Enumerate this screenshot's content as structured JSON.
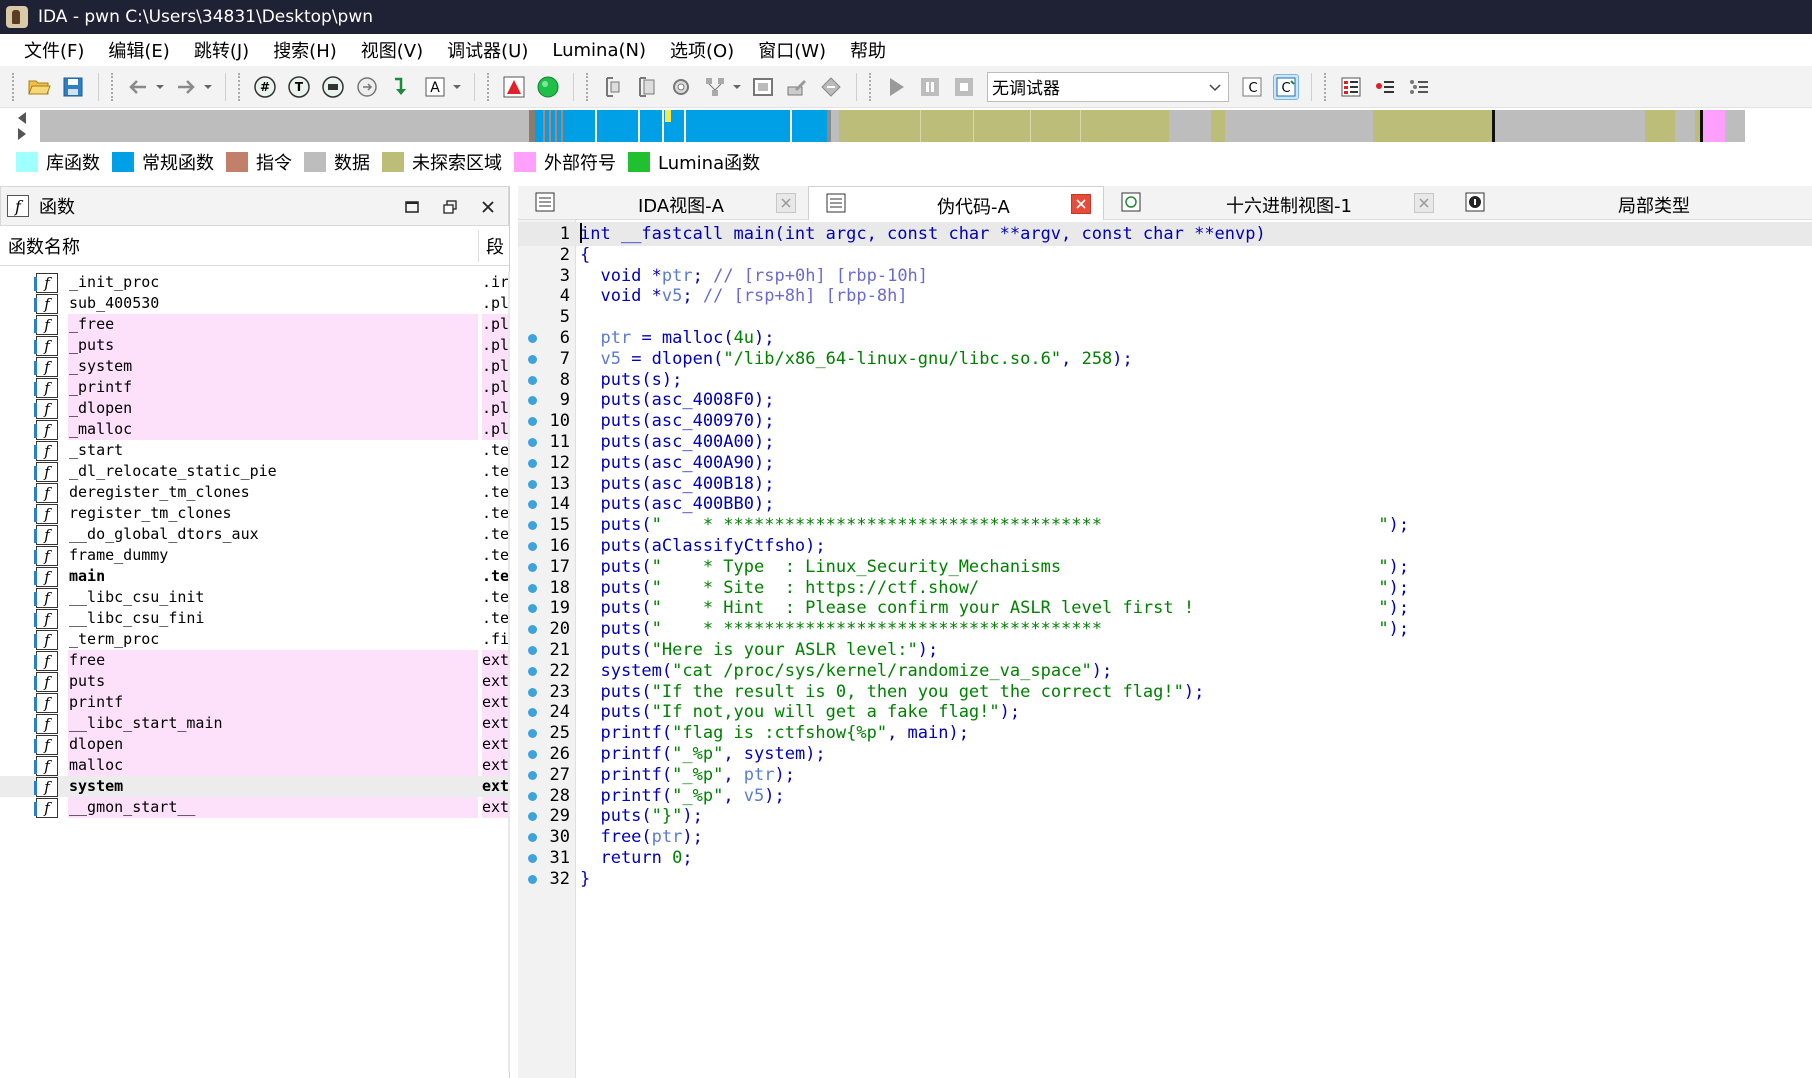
{
  "window": {
    "title": "IDA - pwn C:\\Users\\34831\\Desktop\\pwn"
  },
  "menu": [
    "文件(F)",
    "编辑(E)",
    "跳转(J)",
    "搜索(H)",
    "视图(V)",
    "调试器(U)",
    "Lumina(N)",
    "选项(O)",
    "窗口(W)",
    "帮助"
  ],
  "toolbar": {
    "debugger_select": "无调试器"
  },
  "legend": [
    {
      "label": "库函数",
      "color": "#a0ffff"
    },
    {
      "label": "常规函数",
      "color": "#00a0e6"
    },
    {
      "label": "指令",
      "color": "#c0806a"
    },
    {
      "label": "数据",
      "color": "#bdbdbd"
    },
    {
      "label": "未探索区域",
      "color": "#bdbd7a"
    },
    {
      "label": "外部符号",
      "color": "#ffa0ff"
    },
    {
      "label": "Lumina函数",
      "color": "#20c030"
    }
  ],
  "functions_panel": {
    "title": "函数",
    "col_name": "函数名称",
    "col_segment": "段",
    "rows": [
      {
        "name": "_init_proc",
        "seg": ".ir",
        "style": "normal"
      },
      {
        "name": "sub_400530",
        "seg": ".pl",
        "style": "normal"
      },
      {
        "name": "_free",
        "seg": ".pl",
        "style": "pink"
      },
      {
        "name": "_puts",
        "seg": ".pl",
        "style": "pink"
      },
      {
        "name": "_system",
        "seg": ".pl",
        "style": "pink"
      },
      {
        "name": "_printf",
        "seg": ".pl",
        "style": "pink"
      },
      {
        "name": "_dlopen",
        "seg": ".pl",
        "style": "pink"
      },
      {
        "name": "_malloc",
        "seg": ".pl",
        "style": "pink"
      },
      {
        "name": "_start",
        "seg": ".te",
        "style": "normal"
      },
      {
        "name": "_dl_relocate_static_pie",
        "seg": ".te",
        "style": "normal"
      },
      {
        "name": "deregister_tm_clones",
        "seg": ".te",
        "style": "normal"
      },
      {
        "name": "register_tm_clones",
        "seg": ".te",
        "style": "normal"
      },
      {
        "name": "__do_global_dtors_aux",
        "seg": ".te",
        "style": "normal"
      },
      {
        "name": "frame_dummy",
        "seg": ".te",
        "style": "normal"
      },
      {
        "name": "main",
        "seg": ".te",
        "style": "bold"
      },
      {
        "name": "__libc_csu_init",
        "seg": ".te",
        "style": "normal"
      },
      {
        "name": "__libc_csu_fini",
        "seg": ".te",
        "style": "normal"
      },
      {
        "name": "_term_proc",
        "seg": ".fi",
        "style": "normal"
      },
      {
        "name": "free",
        "seg": "ext",
        "style": "pink"
      },
      {
        "name": "puts",
        "seg": "ext",
        "style": "pink"
      },
      {
        "name": "printf",
        "seg": "ext",
        "style": "pink"
      },
      {
        "name": "__libc_start_main",
        "seg": "ext",
        "style": "pink"
      },
      {
        "name": "dlopen",
        "seg": "ext",
        "style": "pink"
      },
      {
        "name": "malloc",
        "seg": "ext",
        "style": "pink"
      },
      {
        "name": "system",
        "seg": "ext",
        "style": "selected"
      },
      {
        "name": "__gmon_start__",
        "seg": "ext",
        "style": "pink"
      }
    ]
  },
  "tabs": [
    {
      "label": "IDA视图-A",
      "active": false
    },
    {
      "label": "伪代码-A",
      "active": true
    },
    {
      "label": "十六进制视图-1",
      "active": false
    },
    {
      "label": "局部类型",
      "active": false
    }
  ],
  "pseudocode": [
    {
      "n": "1",
      "bp": false,
      "text": "int __fastcall main(int argc, const char **argv, const char **envp)"
    },
    {
      "n": "2",
      "bp": false,
      "text": "{"
    },
    {
      "n": "3",
      "bp": false,
      "text": "  void *ptr; // [rsp+0h] [rbp-10h]"
    },
    {
      "n": "4",
      "bp": false,
      "text": "  void *v5; // [rsp+8h] [rbp-8h]"
    },
    {
      "n": "5",
      "bp": false,
      "text": ""
    },
    {
      "n": "6",
      "bp": true,
      "text": "  ptr = malloc(4u);"
    },
    {
      "n": "7",
      "bp": true,
      "text": "  v5 = dlopen(\"/lib/x86_64-linux-gnu/libc.so.6\", 258);"
    },
    {
      "n": "8",
      "bp": true,
      "text": "  puts(s);"
    },
    {
      "n": "9",
      "bp": true,
      "text": "  puts(asc_4008F0);"
    },
    {
      "n": "10",
      "bp": true,
      "text": "  puts(asc_400970);"
    },
    {
      "n": "11",
      "bp": true,
      "text": "  puts(asc_400A00);"
    },
    {
      "n": "12",
      "bp": true,
      "text": "  puts(asc_400A90);"
    },
    {
      "n": "13",
      "bp": true,
      "text": "  puts(asc_400B18);"
    },
    {
      "n": "14",
      "bp": true,
      "text": "  puts(asc_400BB0);"
    },
    {
      "n": "15",
      "bp": true,
      "text": "  puts(\"    * *************************************                           \");"
    },
    {
      "n": "16",
      "bp": true,
      "text": "  puts(aClassifyCtfsho);"
    },
    {
      "n": "17",
      "bp": true,
      "text": "  puts(\"    * Type  : Linux_Security_Mechanisms                               \");"
    },
    {
      "n": "18",
      "bp": true,
      "text": "  puts(\"    * Site  : https://ctf.show/                                       \");"
    },
    {
      "n": "19",
      "bp": true,
      "text": "  puts(\"    * Hint  : Please confirm your ASLR level first !                  \");"
    },
    {
      "n": "20",
      "bp": true,
      "text": "  puts(\"    * *************************************                           \");"
    },
    {
      "n": "21",
      "bp": true,
      "text": "  puts(\"Here is your ASLR level:\");"
    },
    {
      "n": "22",
      "bp": true,
      "text": "  system(\"cat /proc/sys/kernel/randomize_va_space\");"
    },
    {
      "n": "23",
      "bp": true,
      "text": "  puts(\"If the result is 0, then you get the correct flag!\");"
    },
    {
      "n": "24",
      "bp": true,
      "text": "  puts(\"If not,you will get a fake flag!\");"
    },
    {
      "n": "25",
      "bp": true,
      "text": "  printf(\"flag is :ctfshow{%p\", main);"
    },
    {
      "n": "26",
      "bp": true,
      "text": "  printf(\"_%p\", system);"
    },
    {
      "n": "27",
      "bp": true,
      "text": "  printf(\"_%p\", ptr);"
    },
    {
      "n": "28",
      "bp": true,
      "text": "  printf(\"_%p\", v5);"
    },
    {
      "n": "29",
      "bp": true,
      "text": "  puts(\"}\");"
    },
    {
      "n": "30",
      "bp": true,
      "text": "  free(ptr);"
    },
    {
      "n": "31",
      "bp": true,
      "text": "  return 0;"
    },
    {
      "n": "32",
      "bp": true,
      "text": "}"
    }
  ]
}
